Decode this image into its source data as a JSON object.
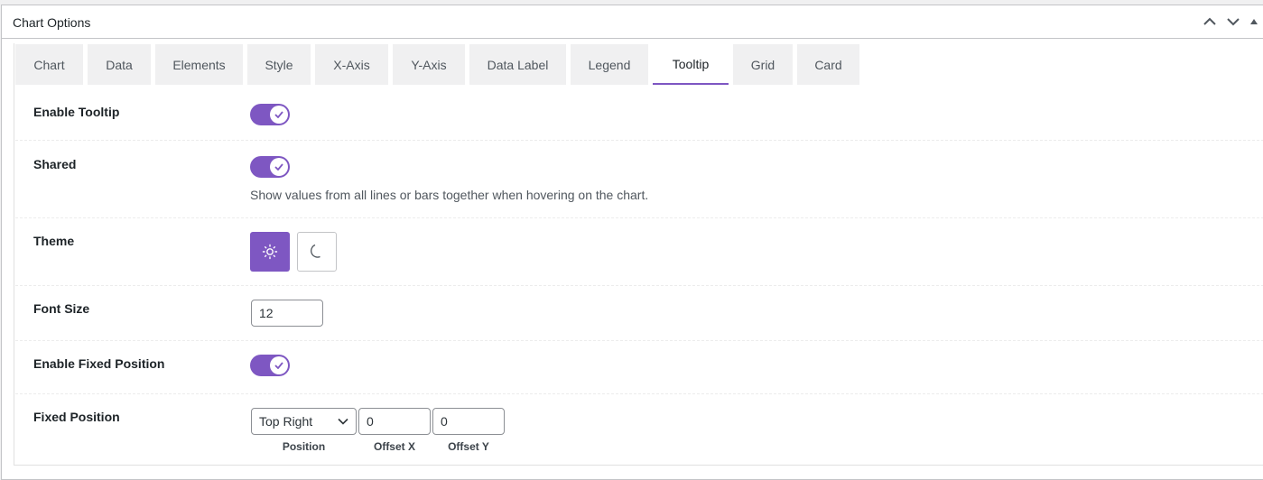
{
  "metabox": {
    "title": "Chart Options"
  },
  "header_actions": [
    {
      "name": "move-up",
      "icon": "chevron-up-icon"
    },
    {
      "name": "move-down",
      "icon": "chevron-down-icon"
    },
    {
      "name": "toggle-panel",
      "icon": "triangle-up-icon"
    }
  ],
  "tabs": [
    {
      "label": "Chart",
      "active": false
    },
    {
      "label": "Data",
      "active": false
    },
    {
      "label": "Elements",
      "active": false
    },
    {
      "label": "Style",
      "active": false
    },
    {
      "label": "X-Axis",
      "active": false
    },
    {
      "label": "Y-Axis",
      "active": false
    },
    {
      "label": "Data Label",
      "active": false
    },
    {
      "label": "Legend",
      "active": false
    },
    {
      "label": "Tooltip",
      "active": true
    },
    {
      "label": "Grid",
      "active": false
    },
    {
      "label": "Card",
      "active": false
    }
  ],
  "settings": {
    "enable_tooltip": {
      "label": "Enable Tooltip",
      "enabled": true
    },
    "shared": {
      "label": "Shared",
      "enabled": true,
      "description": "Show values from all lines or bars together when hovering on the chart."
    },
    "theme": {
      "label": "Theme",
      "selected": "light",
      "options": [
        "sun-icon",
        "moon-icon"
      ]
    },
    "font_size": {
      "label": "Font Size",
      "value": "12"
    },
    "enable_fixed_position": {
      "label": "Enable Fixed Position",
      "enabled": true
    },
    "fixed_position": {
      "label": "Fixed Position",
      "position_value": "Top Right",
      "offset_x_value": "0",
      "offset_y_value": "0",
      "position_label": "Position",
      "offset_x_label": "Offset X",
      "offset_y_label": "Offset Y"
    }
  },
  "colors": {
    "accent": "#7e57c2",
    "border": "#c3c4c7",
    "tab_bg": "#f0f0f1",
    "text": "#1d2327"
  }
}
